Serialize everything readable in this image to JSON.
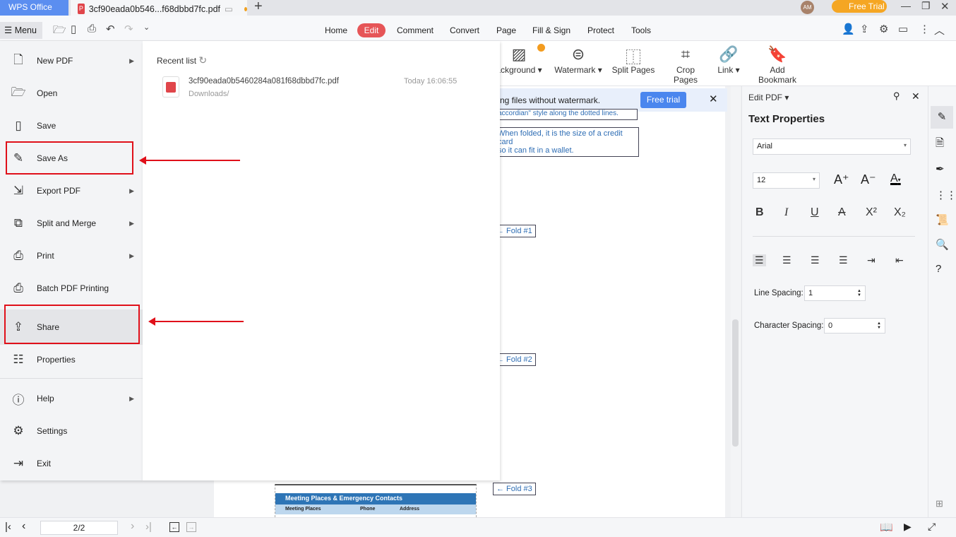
{
  "titlebar": {
    "app_tab": "WPS Office",
    "doc_tab": "3cf90eada0b546...f68dbbd7fc.pdf",
    "avatar": "AM",
    "free_trial": "Free Trial"
  },
  "toolbar": {
    "menu": "Menu",
    "tabs": [
      "Home",
      "Edit",
      "Comment",
      "Convert",
      "Page",
      "Fill & Sign",
      "Protect",
      "Tools"
    ]
  },
  "ribbon": {
    "items": [
      "ackground",
      "Watermark",
      "Split Pages",
      "Crop Pages",
      "Link",
      "Add Bookmark"
    ]
  },
  "banner": {
    "text": "ng files without watermark.",
    "button": "Free trial"
  },
  "document": {
    "note1": "accordian\" style along the dotted lines.",
    "note2a": "When folded, it is the size of a credit card",
    "note2b": "so it can fit in a wallet.",
    "fold1": "← Fold #1",
    "fold2": "← Fold #2",
    "fold3": "← Fold #3",
    "table_title": "Meeting Places & Emergency Contacts",
    "col1": "Meeting Places",
    "col2": "Phone",
    "col3": "Address",
    "table_color": "#2e75b6"
  },
  "menu": {
    "items": [
      {
        "label": "New PDF"
      },
      {
        "label": "Open"
      },
      {
        "label": "Save"
      },
      {
        "label": "Save As"
      },
      {
        "label": "Export PDF"
      },
      {
        "label": "Split and Merge"
      },
      {
        "label": "Print"
      },
      {
        "label": "Batch PDF Printing"
      },
      {
        "label": "Share"
      },
      {
        "label": "Properties"
      },
      {
        "label": "Help"
      },
      {
        "label": "Settings"
      },
      {
        "label": "Exit"
      }
    ]
  },
  "recent": {
    "title": "Recent list",
    "file_name": "3cf90eada0b5460284a081f68dbbd7fc.pdf",
    "file_path": "Downloads/",
    "file_time": "Today 16:06:55"
  },
  "panel": {
    "header": "Edit PDF",
    "title": "Text Properties",
    "font": "Arial",
    "size": "12",
    "line_spacing_label": "Line Spacing:",
    "line_spacing": "1",
    "char_spacing_label": "Character Spacing:",
    "char_spacing": "0"
  },
  "bottom": {
    "page": "2/2"
  }
}
